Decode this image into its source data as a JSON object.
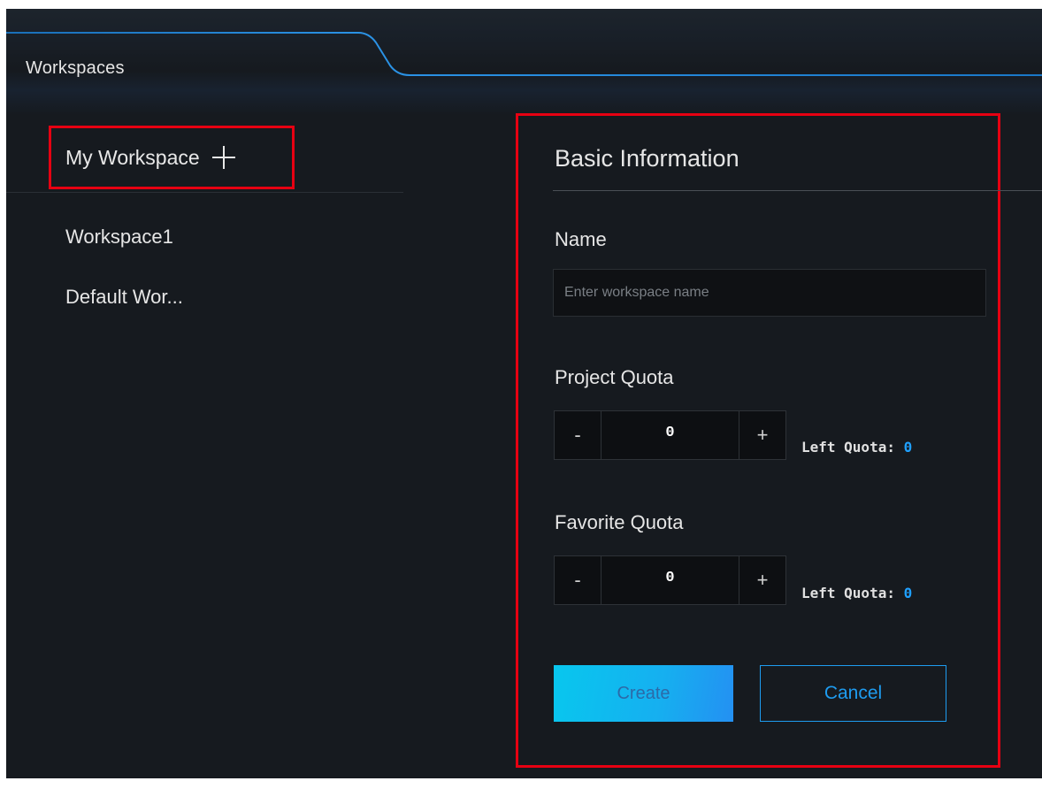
{
  "tab": {
    "title": "Workspaces"
  },
  "sidebar": {
    "header_label": "My Workspace",
    "items": [
      {
        "label": "Workspace1"
      },
      {
        "label": "Default Wor..."
      }
    ]
  },
  "form": {
    "section_title": "Basic Information",
    "name_label": "Name",
    "name_value": "",
    "name_placeholder": "Enter workspace name",
    "project_quota": {
      "label": "Project Quota",
      "value": "0",
      "left_label": "Left Quota:",
      "left_value": "0"
    },
    "favorite_quota": {
      "label": "Favorite Quota",
      "value": "0",
      "left_label": "Left Quota:",
      "left_value": "0"
    },
    "stepper_minus": "-",
    "stepper_plus": "+",
    "create_label": "Create",
    "cancel_label": "Cancel"
  },
  "colors": {
    "background": "#161a1f",
    "accent": "#1fa0ff",
    "highlight_outline": "#e60012",
    "tab_line": "#1976c4"
  },
  "icons": {
    "add_workspace": "plus-icon"
  }
}
